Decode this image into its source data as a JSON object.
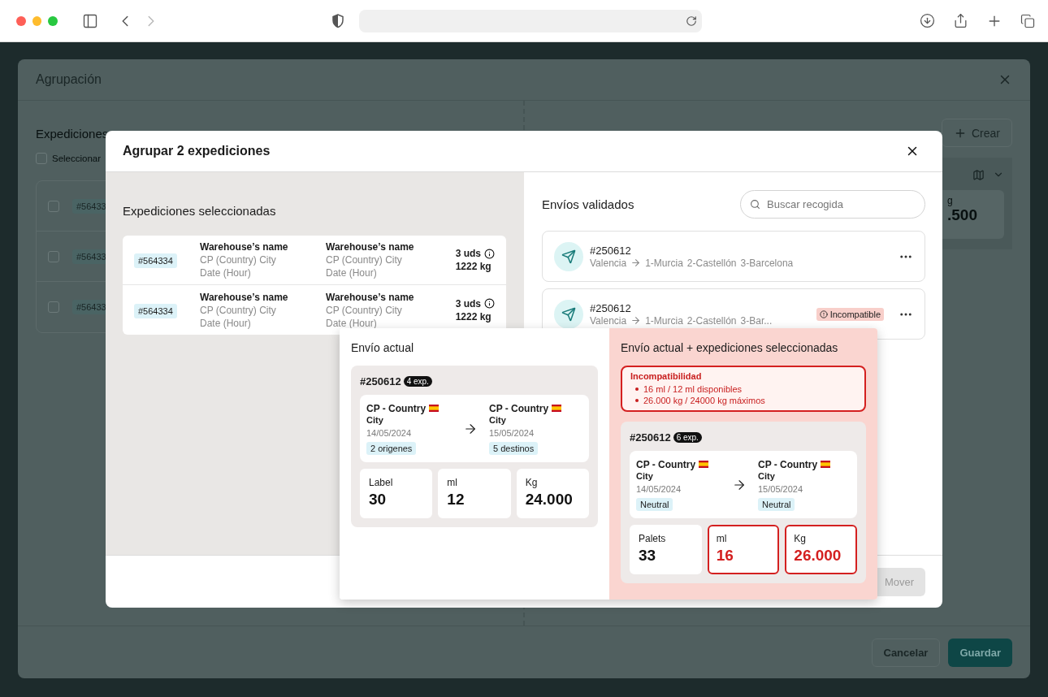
{
  "background": {
    "title": "Agrupación",
    "left_title": "Expediciones",
    "select_all": {
      "label": "Seleccionar",
      "checked": false
    },
    "rows": [
      {
        "tag": "#56433",
        "checked": false
      },
      {
        "tag": "#56433",
        "checked": false
      },
      {
        "tag": "#56433",
        "checked": false
      }
    ],
    "create_button": "Crear",
    "summary": {
      "label": "g",
      "value": ".500"
    },
    "buttons": [
      {
        "label": "Cancelar",
        "kind": "secondary"
      },
      {
        "label": "Guardar",
        "kind": "primary"
      }
    ]
  },
  "dialog": {
    "title": "Agrupar 2 expediciones",
    "selected_title": "Expediciones seleccionadas",
    "expeditions": [
      {
        "tag": "#564334",
        "origin": {
          "name": "Warehouse’s name",
          "address": "CP (Country) City",
          "date": "Date (Hour)"
        },
        "destination": {
          "name": "Warehouse’s name",
          "address": "CP (Country) City",
          "date": "Date (Hour)"
        },
        "units": "3 uds",
        "weight": "1222 kg"
      },
      {
        "tag": "#564334",
        "origin": {
          "name": "Warehouse’s name",
          "address": "CP (Country) City",
          "date": "Date (Hour)"
        },
        "destination": {
          "name": "Warehouse’s name",
          "address": "CP (Country) City",
          "date": "Date (Hour)"
        },
        "units": "3 uds",
        "weight": "1222 kg"
      }
    ],
    "shipments_title": "Envíos validados",
    "search": {
      "placeholder": "Buscar recogida"
    },
    "shipments": [
      {
        "id": "#250612",
        "origin": "Valencia",
        "stops": [
          "1-Murcia",
          "2-Castellón",
          "3-Barcelona"
        ]
      },
      {
        "id": "#250612",
        "origin": "Valencia",
        "stops": [
          "1-Murcia",
          "2-Castellón",
          "3-Bar..."
        ],
        "badge": "Incompatible"
      }
    ],
    "move_button": {
      "label": "Mover",
      "disabled": true
    }
  },
  "comparison": {
    "current": {
      "title": "Envío actual",
      "shipment": {
        "id": "#250612",
        "count": "4 exp.",
        "origin": {
          "place": "CP - Country",
          "city": "City",
          "date": "14/05/2024",
          "tag": "2 origenes"
        },
        "destination": {
          "place": "CP - Country",
          "city": "City",
          "date": "15/05/2024",
          "tag": "5 destinos"
        },
        "metrics": [
          {
            "label": "Label",
            "value": "30",
            "exceeded": false
          },
          {
            "label": "ml",
            "value": "12",
            "exceeded": false
          },
          {
            "label": "Kg",
            "value": "24.000",
            "exceeded": false
          }
        ]
      }
    },
    "combined": {
      "title": "Envío actual + expediciones seleccionadas",
      "alert": {
        "title": "Incompatibilidad",
        "items": [
          "16 ml / 12 ml disponibles",
          "26.000 kg / 24000 kg máximos"
        ]
      },
      "shipment": {
        "id": "#250612",
        "count": "6 exp.",
        "origin": {
          "place": "CP - Country",
          "city": "City",
          "date": "14/05/2024",
          "tag": "Neutral"
        },
        "destination": {
          "place": "CP - Country",
          "city": "City",
          "date": "15/05/2024",
          "tag": "Neutral"
        },
        "metrics": [
          {
            "label": "Palets",
            "value": "33",
            "exceeded": false
          },
          {
            "label": "ml",
            "value": "16",
            "exceeded": true
          },
          {
            "label": "Kg",
            "value": "26.000",
            "exceeded": true
          }
        ]
      }
    }
  }
}
